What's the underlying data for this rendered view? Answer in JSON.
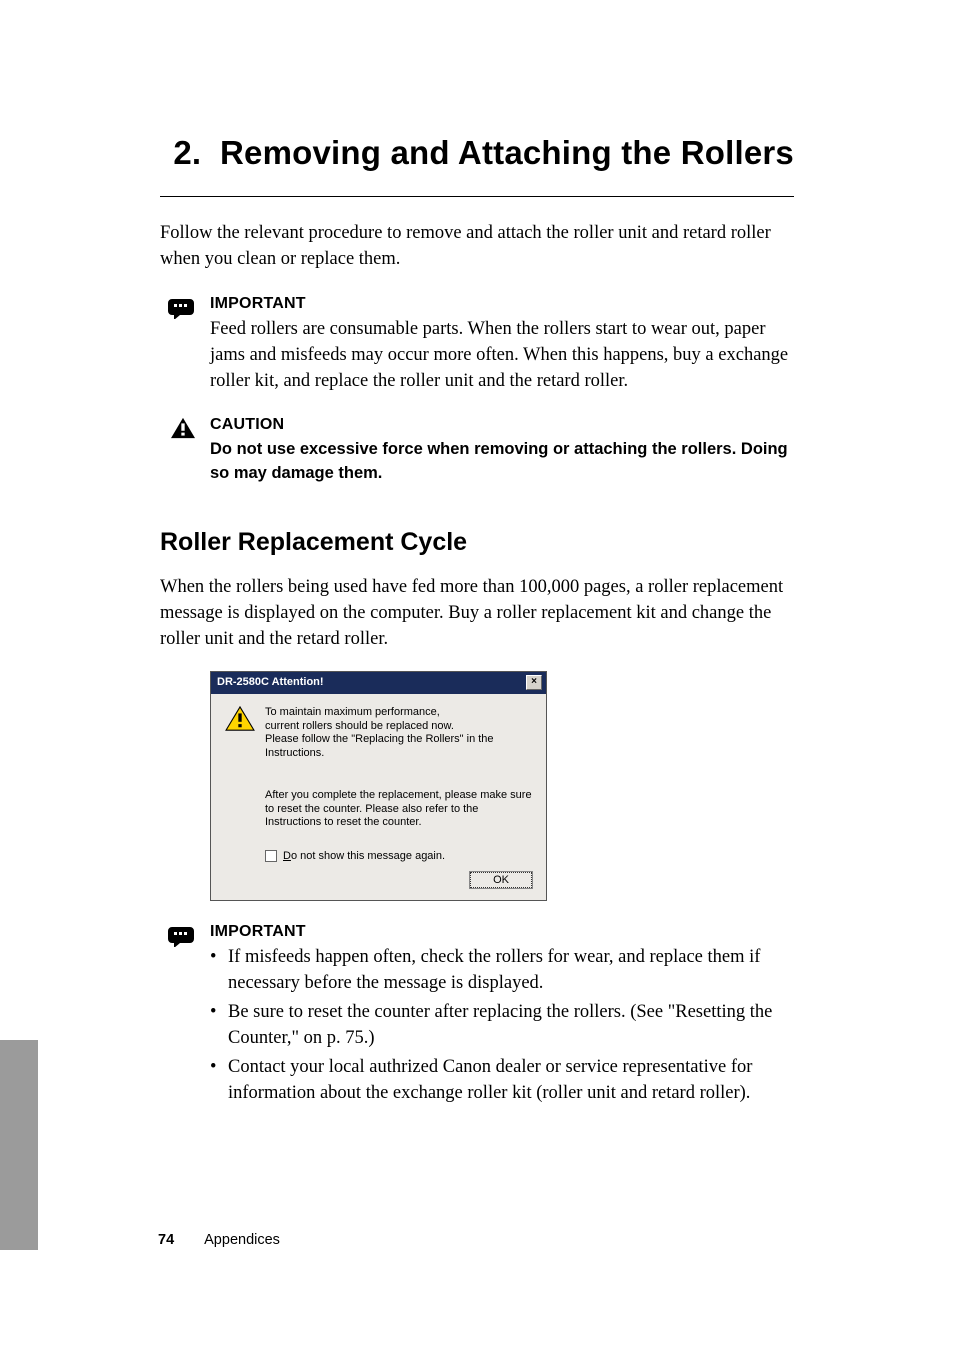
{
  "chapter": {
    "number_label": "2.",
    "title": "Removing and Attaching the Rollers"
  },
  "intro": "Follow the relevant procedure to remove and attach the roller unit and retard roller when you clean or replace them.",
  "important1": {
    "heading": "IMPORTANT",
    "body": "Feed rollers are consumable parts. When the rollers start to wear out, paper jams and misfeeds may occur more often. When this happens, buy a exchange roller kit, and replace the roller unit and the retard roller."
  },
  "caution": {
    "heading": "CAUTION",
    "body": "Do not use excessive force when removing or attaching the rollers. Doing so may damage them."
  },
  "section": {
    "heading": "Roller Replacement Cycle",
    "body": "When the rollers being used have fed more than 100,000 pages, a roller replacement message is displayed on the computer. Buy a roller replacement kit and change the roller unit and the retard roller."
  },
  "dialog": {
    "title": "DR-2580C Attention!",
    "close_glyph": "×",
    "msg_line1": "To maintain maximum performance,",
    "msg_line2": "current rollers should be replaced now.",
    "msg_line3": "Please follow the \"Replacing the Rollers\" in the Instructions.",
    "msg2": "After you complete the replacement, please make sure to reset the counter. Please also refer to the Instructions to reset the counter.",
    "checkbox_accesskey": "D",
    "checkbox_label_rest": "o not show this message again.",
    "ok_label": "OK"
  },
  "important2": {
    "heading": "IMPORTANT",
    "bullets": [
      "If misfeeds happen often, check the rollers for wear, and replace them if necessary before the message is displayed.",
      "Be sure to reset the counter after replacing the rollers. (See \"Resetting the Counter,\" on p. 75.)",
      "Contact your local authrized Canon dealer or service representative for information about the exchange roller kit (roller unit and retard roller)."
    ]
  },
  "footer": {
    "page_number": "74",
    "section_label": "Appendices"
  }
}
